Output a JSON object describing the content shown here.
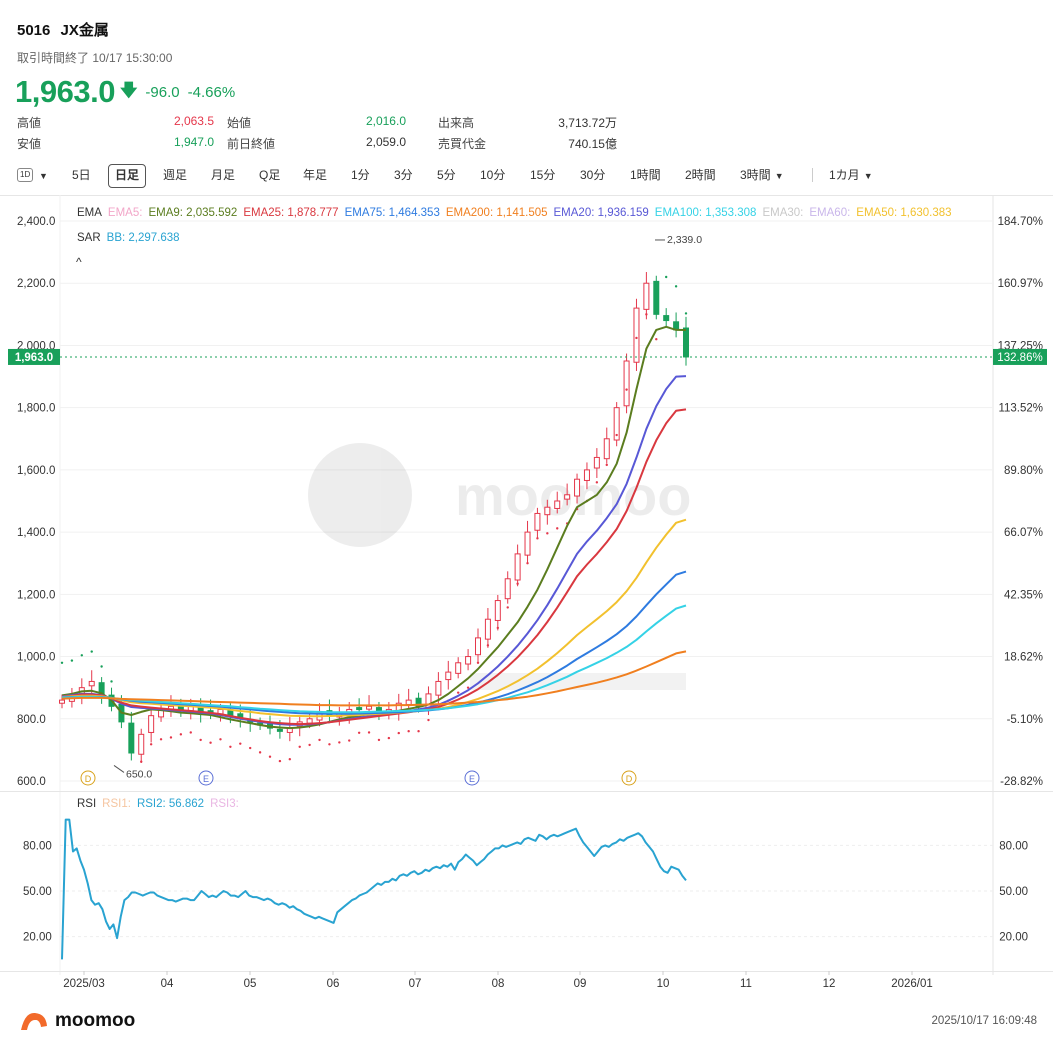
{
  "header": {
    "code": "5016",
    "name": "JX金属",
    "status": "取引時間終了 10/17 15:30:00",
    "price": "1,963.0",
    "change": "-96.0",
    "change_pct": "-4.66%"
  },
  "stats": {
    "high_label": "高値",
    "high": "2,063.5",
    "open_label": "始値",
    "open": "2,016.0",
    "volume_label": "出来高",
    "volume": "3,713.72万",
    "low_label": "安値",
    "low": "1,947.0",
    "prev_label": "前日終値",
    "prev": "2,059.0",
    "turnover_label": "売買代金",
    "turnover": "740.15億"
  },
  "toolbar": {
    "icon": "1D",
    "items": [
      "5日",
      "日足",
      "週足",
      "月足",
      "Q足",
      "年足",
      "1分",
      "3分",
      "5分",
      "10分",
      "15分",
      "30分",
      "1時間",
      "2時間"
    ],
    "more1": "3時間",
    "more2": "1カ月",
    "active_index": 1
  },
  "legend": {
    "row1": [
      {
        "t": "EMA",
        "c": "#333333"
      },
      {
        "t": "EMA5:",
        "c": "#f2a6c8"
      },
      {
        "t": "EMA9: 2,035.592",
        "c": "#5b7d1f"
      },
      {
        "t": "EMA25: 1,878.777",
        "c": "#d9383f"
      },
      {
        "t": "EMA75: 1,464.353",
        "c": "#2e7be0"
      },
      {
        "t": "EMA200: 1,141.505",
        "c": "#f07f1f"
      },
      {
        "t": "EMA20: 1,936.159",
        "c": "#5858d6"
      },
      {
        "t": "EMA100: 1,353.308",
        "c": "#35d2e6"
      },
      {
        "t": "EMA30:",
        "c": "#c8c8c8"
      },
      {
        "t": "EMA60:",
        "c": "#c9b6ea"
      },
      {
        "t": "EMA50: 1,630.383",
        "c": "#f2c12e"
      }
    ],
    "row2": [
      {
        "t": "SAR",
        "c": "#333333"
      },
      {
        "t": "BB: 2,297.638",
        "c": "#29a3d1"
      }
    ],
    "collapse": "^"
  },
  "rsi_legend": [
    {
      "t": "RSI",
      "c": "#333333"
    },
    {
      "t": "RSI1:",
      "c": "#f5c5a0"
    },
    {
      "t": "RSI2: 56.862",
      "c": "#29a3d1"
    },
    {
      "t": "RSI3:",
      "c": "#e9b6e3"
    }
  ],
  "colors": {
    "up": "#e5374b",
    "down": "#18a05a",
    "accent": "#18a05a"
  },
  "chart_data": [
    {
      "type": "line",
      "title": "",
      "price_axis": {
        "ylim": [
          600,
          2400
        ],
        "ticks": [
          "600.0",
          "800.0",
          "1,000.0",
          "1,200.0",
          "1,400.0",
          "1,600.0",
          "1,800.0",
          "2,000.0",
          "2,200.0",
          "2,400.0"
        ]
      },
      "pct_axis": {
        "ticks": [
          "-28.82%",
          "-5.10%",
          "18.62%",
          "42.35%",
          "66.07%",
          "89.80%",
          "113.52%",
          "137.25%",
          "160.97%",
          "184.70%"
        ]
      },
      "x_labels": [
        "2025/03",
        "04",
        "05",
        "06",
        "07",
        "08",
        "09",
        "10",
        "11",
        "12",
        "2026/01"
      ],
      "last_price_label": "1,963.0",
      "last_pct_label": "132.86%",
      "annotations": {
        "high": "2,339.0",
        "low": "650.0"
      },
      "event_markers": [
        "D",
        "E",
        "E",
        "D"
      ],
      "watermark": "moomoo",
      "series": [
        {
          "name": "EMA9",
          "color": "#5b7d1f",
          "values": [
            875,
            880,
            888,
            890,
            882,
            860,
            820,
            812,
            822,
            830,
            828,
            824,
            820,
            818,
            815,
            812,
            805,
            798,
            792,
            786,
            780,
            775,
            772,
            770,
            772,
            776,
            782,
            790,
            798,
            805,
            810,
            815,
            818,
            822,
            826,
            832,
            838,
            846,
            860,
            880,
            905,
            930,
            960,
            995,
            1030,
            1070,
            1110,
            1160,
            1215,
            1280,
            1350,
            1420,
            1480,
            1500,
            1520,
            1560,
            1620,
            1720,
            1860,
            1990,
            2050,
            2060,
            2050,
            2040
          ]
        },
        {
          "name": "EMA20",
          "color": "#5858d6",
          "values": [
            872,
            876,
            880,
            880,
            876,
            865,
            848,
            838,
            835,
            833,
            831,
            828,
            826,
            823,
            820,
            817,
            812,
            806,
            800,
            795,
            790,
            786,
            783,
            781,
            781,
            782,
            785,
            789,
            794,
            799,
            804,
            808,
            812,
            816,
            820,
            825,
            830,
            836,
            845,
            858,
            874,
            892,
            914,
            940,
            968,
            1000,
            1035,
            1074,
            1117,
            1165,
            1218,
            1274,
            1330,
            1370,
            1405,
            1445,
            1490,
            1555,
            1640,
            1732,
            1805,
            1860,
            1900,
            1930
          ]
        },
        {
          "name": "EMA25",
          "color": "#d9383f",
          "values": [
            871,
            874,
            878,
            878,
            875,
            866,
            852,
            843,
            839,
            836,
            833,
            830,
            828,
            825,
            822,
            819,
            815,
            809,
            803,
            798,
            793,
            789,
            786,
            784,
            783,
            784,
            786,
            789,
            793,
            797,
            801,
            805,
            809,
            813,
            817,
            821,
            826,
            831,
            838,
            849,
            862,
            877,
            895,
            917,
            941,
            968,
            998,
            1032,
            1069,
            1111,
            1157,
            1207,
            1258,
            1296,
            1330,
            1368,
            1410,
            1468,
            1543,
            1626,
            1695,
            1750,
            1790,
            1880
          ]
        },
        {
          "name": "EMA50",
          "color": "#f2c12e",
          "values": [
            870,
            872,
            874,
            874,
            872,
            867,
            859,
            853,
            850,
            848,
            846,
            844,
            842,
            840,
            838,
            836,
            833,
            829,
            825,
            822,
            818,
            815,
            812,
            810,
            809,
            808,
            808,
            809,
            810,
            811,
            812,
            814,
            816,
            818,
            820,
            822,
            825,
            828,
            832,
            838,
            845,
            854,
            864,
            876,
            889,
            904,
            921,
            940,
            961,
            985,
            1011,
            1039,
            1069,
            1095,
            1120,
            1146,
            1175,
            1210,
            1253,
            1303,
            1350,
            1392,
            1430,
            1630
          ]
        },
        {
          "name": "EMA75",
          "color": "#2e7be0",
          "values": [
            869,
            870,
            871,
            871,
            870,
            867,
            862,
            858,
            855,
            853,
            851,
            849,
            847,
            845,
            843,
            841,
            839,
            836,
            833,
            830,
            827,
            824,
            822,
            820,
            818,
            817,
            816,
            816,
            816,
            816,
            817,
            818,
            819,
            820,
            821,
            823,
            825,
            827,
            830,
            834,
            839,
            845,
            852,
            860,
            869,
            879,
            891,
            904,
            918,
            934,
            952,
            971,
            992,
            1011,
            1030,
            1050,
            1072,
            1098,
            1129,
            1165,
            1200,
            1232,
            1263,
            1464
          ]
        },
        {
          "name": "EMA100",
          "color": "#35d2e6",
          "values": [
            868,
            869,
            870,
            870,
            869,
            867,
            863,
            860,
            858,
            856,
            854,
            852,
            850,
            848,
            846,
            844,
            842,
            840,
            837,
            835,
            832,
            830,
            828,
            826,
            824,
            823,
            822,
            821,
            821,
            821,
            821,
            822,
            823,
            824,
            825,
            826,
            827,
            829,
            831,
            834,
            838,
            842,
            847,
            853,
            860,
            867,
            876,
            885,
            896,
            908,
            921,
            935,
            951,
            965,
            980,
            995,
            1012,
            1031,
            1054,
            1081,
            1107,
            1131,
            1154,
            1353
          ]
        },
        {
          "name": "EMA200",
          "color": "#f07f1f",
          "values": [
            865,
            866,
            867,
            867,
            867,
            866,
            864,
            863,
            862,
            861,
            860,
            859,
            858,
            857,
            856,
            855,
            854,
            853,
            852,
            851,
            850,
            849,
            848,
            847,
            846,
            845,
            844,
            844,
            843,
            843,
            843,
            843,
            843,
            843,
            844,
            844,
            845,
            846,
            847,
            848,
            850,
            852,
            854,
            857,
            860,
            863,
            867,
            871,
            876,
            882,
            888,
            895,
            902,
            909,
            916,
            924,
            933,
            943,
            955,
            968,
            982,
            996,
            1010,
            1142
          ]
        }
      ],
      "candles_close": [
        860,
        875,
        900,
        920,
        880,
        840,
        790,
        690,
        750,
        810,
        830,
        840,
        830,
        840,
        820,
        815,
        830,
        810,
        800,
        790,
        780,
        770,
        760,
        770,
        790,
        800,
        820,
        810,
        820,
        830,
        835,
        840,
        820,
        830,
        850,
        860,
        840,
        880,
        920,
        950,
        980,
        1000,
        1060,
        1120,
        1180,
        1250,
        1330,
        1400,
        1460,
        1480,
        1500,
        1520,
        1570,
        1600,
        1640,
        1700,
        1800,
        1950,
        2120,
        2200,
        2100,
        2080,
        2050,
        1963
      ]
    },
    {
      "type": "line",
      "title": "",
      "y_ticks": [
        "20.00",
        "50.00",
        "80.00"
      ],
      "ylim": [
        0,
        100
      ],
      "series": [
        {
          "name": "RSI2",
          "color": "#29a3d1",
          "values": [
            5,
            97,
            97,
            76,
            78,
            70,
            64,
            55,
            44,
            41,
            42,
            38,
            30,
            25,
            28,
            19,
            33,
            44,
            46,
            49,
            49,
            48,
            47,
            48,
            49,
            49,
            47,
            46,
            45,
            44,
            44,
            43,
            44,
            45,
            45,
            44,
            44,
            47,
            50,
            48,
            46,
            47,
            46,
            48,
            50,
            49,
            47,
            47,
            46,
            48,
            50,
            47,
            46,
            46,
            45,
            44,
            45,
            44,
            42,
            41,
            42,
            41,
            39,
            40,
            38,
            37,
            35,
            34,
            33,
            32,
            33,
            32,
            31,
            30,
            29,
            36,
            38,
            40,
            42,
            44,
            45,
            47,
            48,
            49,
            51,
            53,
            55,
            54,
            56,
            56,
            58,
            57,
            60,
            61,
            60,
            62,
            63,
            61,
            62,
            64,
            63,
            65,
            66,
            65,
            67,
            66,
            68,
            64,
            69,
            71,
            74,
            72,
            70,
            67,
            69,
            71,
            74,
            76,
            78,
            78,
            80,
            79,
            80,
            81,
            82,
            81,
            84,
            85,
            84,
            83,
            87,
            86,
            84,
            86,
            87,
            86,
            87,
            88,
            89,
            90,
            91,
            86,
            82,
            79,
            76,
            73,
            76,
            79,
            80,
            79,
            81,
            82,
            84,
            83,
            85,
            86,
            87,
            88,
            86,
            82,
            79,
            76,
            71,
            66,
            63,
            62,
            66,
            65,
            64,
            60,
            57
          ]
        }
      ]
    }
  ],
  "footer": {
    "brand": "moomoo",
    "timestamp": "2025/10/17 16:09:48"
  }
}
